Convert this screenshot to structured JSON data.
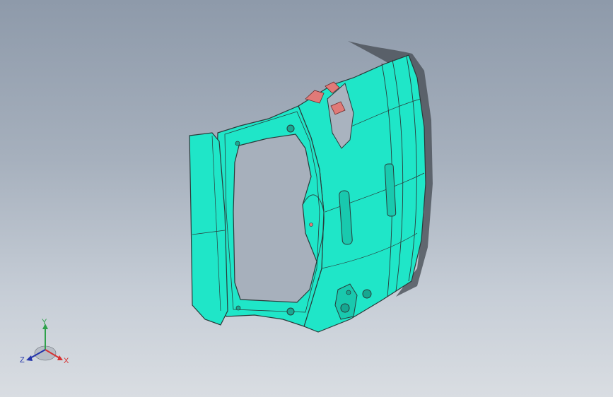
{
  "viewport": {
    "background_top": "#8e9aaa",
    "background_bottom": "#d9dde2"
  },
  "model": {
    "part_color": "#1fe6c8",
    "edge_color": "#2a3a3a",
    "feature_color": "#e07a78",
    "shadow_color": "#4a5058"
  },
  "triad": {
    "x_label": "X",
    "y_label": "Y",
    "z_label": "Z",
    "x_color": "#d63232",
    "y_color": "#2ea14b",
    "z_color": "#2233aa"
  }
}
